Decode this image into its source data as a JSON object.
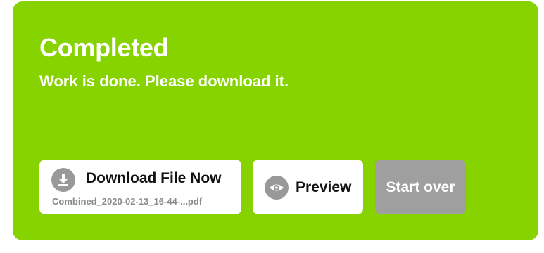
{
  "status": {
    "title": "Completed",
    "message": "Work is done. Please download it."
  },
  "actions": {
    "download": {
      "label": "Download File Now",
      "filename": "Combined_2020-02-13_16-44-...pdf",
      "icon": "download-icon"
    },
    "preview": {
      "label": "Preview",
      "icon": "eye-icon"
    },
    "start_over": {
      "label": "Start over"
    }
  },
  "colors": {
    "panel_background": "#86d300",
    "button_background": "#ffffff",
    "icon_circle": "#999999",
    "disabled_button": "#9f9f9f",
    "text_dark": "#111111",
    "text_muted": "#8a8a8a"
  }
}
